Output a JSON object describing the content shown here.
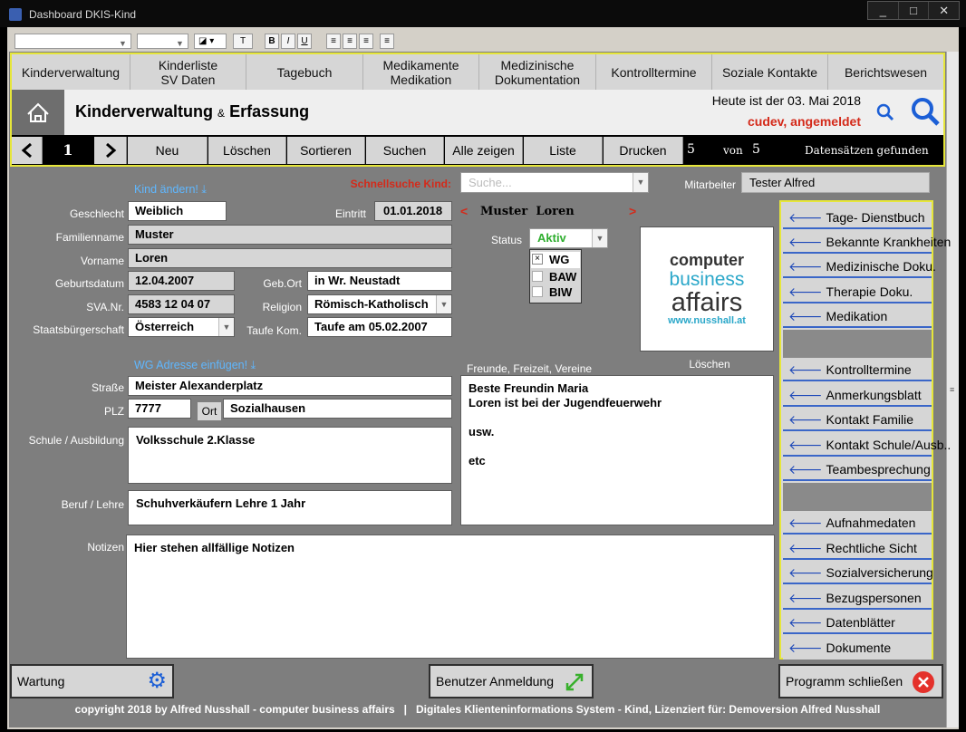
{
  "window": {
    "title": "Dashboard DKIS-Kind",
    "controls": [
      "_",
      "□",
      "✕"
    ]
  },
  "nav": [
    "Kinderverwaltung",
    "Kinderliste\nSV Daten",
    "Tagebuch",
    "Medikamente\nMedikation",
    "Medizinische\nDokumentation",
    "Kontrolltermine",
    "Soziale Kontakte",
    "Berichtswesen"
  ],
  "header": {
    "title": "Kinderverwaltung",
    "amp": "&",
    "title2": "Erfassung",
    "today": "Heute ist der 03. Mai 2018",
    "user": "cudev, angemeldet"
  },
  "records": {
    "current": "1",
    "buttons": [
      "Neu",
      "Löschen",
      "Sortieren",
      "Suchen",
      "Alle zeigen",
      "Liste",
      "Drucken"
    ],
    "count": "5",
    "of": "von",
    "total": "5",
    "found": "Datensätzen gefunden"
  },
  "form": {
    "kind_aendern": "Kind ändern!",
    "schnellsuche_label": "Schnellsuche Kind:",
    "schnellsuche_placeholder": "Suche...",
    "mitarbeiter_label": "Mitarbeiter",
    "mitarbeiter": "Tester Alfred",
    "geschlecht_label": "Geschlecht",
    "geschlecht": "Weiblich",
    "eintritt_label": "Eintritt",
    "eintritt": "01.01.2018",
    "prev": "<",
    "name_display": "Muster  Loren",
    "next": ">",
    "familienname_label": "Familienname",
    "familienname": "Muster",
    "vorname_label": "Vorname",
    "vorname": "Loren",
    "status_label": "Status",
    "status": "Aktiv",
    "checks": [
      {
        "label": "WG",
        "checked": true
      },
      {
        "label": "BAW",
        "checked": false
      },
      {
        "label": "BIW",
        "checked": false
      }
    ],
    "geburtsdatum_label": "Geburtsdatum",
    "geburtsdatum": "12.04.2007",
    "geburtsort_label": "Geb.Ort",
    "geburtsort": "in Wr. Neustadt",
    "sva_label": "SVA.Nr.",
    "sva": "4583 12 04 07",
    "religion_label": "Religion",
    "religion": "Römisch-Katholisch",
    "staat_label": "Staatsbürgerschaft",
    "staat": "Österreich",
    "taufe_label": "Taufe Kom.",
    "taufe": "Taufe am 05.02.2007",
    "logo": {
      "line1": "computer",
      "line2": "business",
      "line3": "affairs",
      "url": "www.nusshall.at"
    },
    "loeschen": "Löschen",
    "wg_adresse": "WG Adresse einfügen!",
    "freunde_label": "Freunde, Freizeit, Vereine",
    "strasse_label": "Straße",
    "strasse": "Meister Alexanderplatz",
    "plz_label": "PLZ",
    "plz": "7777",
    "ort_label": "Ort",
    "ort": "Sozialhausen",
    "schule_label": "Schule / Ausbildung",
    "schule": "Volksschule 2.Klasse",
    "beruf_label": "Beruf  / Lehre",
    "beruf": "Schuhverkäufern Lehre 1 Jahr",
    "freunde": [
      "Beste Freundin Maria",
      "Loren ist bei der Jugendfeuerwehr",
      "",
      "usw.",
      "",
      "etc"
    ],
    "notizen_label": "Notizen",
    "notizen": "Hier stehen allfällige Notizen"
  },
  "sidebar": {
    "group1": [
      "Tage- Dienstbuch",
      "Bekannte Krankheiten",
      "Medizinische Doku.",
      "Therapie Doku.",
      "Medikation"
    ],
    "group2": [
      "Kontrolltermine",
      "Anmerkungsblatt",
      "Kontakt Familie",
      "Kontakt Schule/Ausb..",
      "Teambesprechung"
    ],
    "group3": [
      "Aufnahmedaten",
      "Rechtliche Sicht",
      "Sozialversicherung",
      "Bezugspersonen",
      "Datenblätter",
      "Dokumente"
    ]
  },
  "bottom": {
    "wartung": "Wartung",
    "benutzer": "Benutzer Anmeldung",
    "schliessen": "Programm schließen"
  },
  "footer": "copyright 2018 by Alfred Nusshall - computer business affairs   |   Digitales Klienteninformations System - Kind, Lizenziert für: Demoversion Alfred Nusshall",
  "colors": {
    "accent_yellow": "#e6e63a",
    "user_red": "#d42a1a",
    "link_blue": "#5fb7ff",
    "arrow_blue": "#1c47b8"
  }
}
